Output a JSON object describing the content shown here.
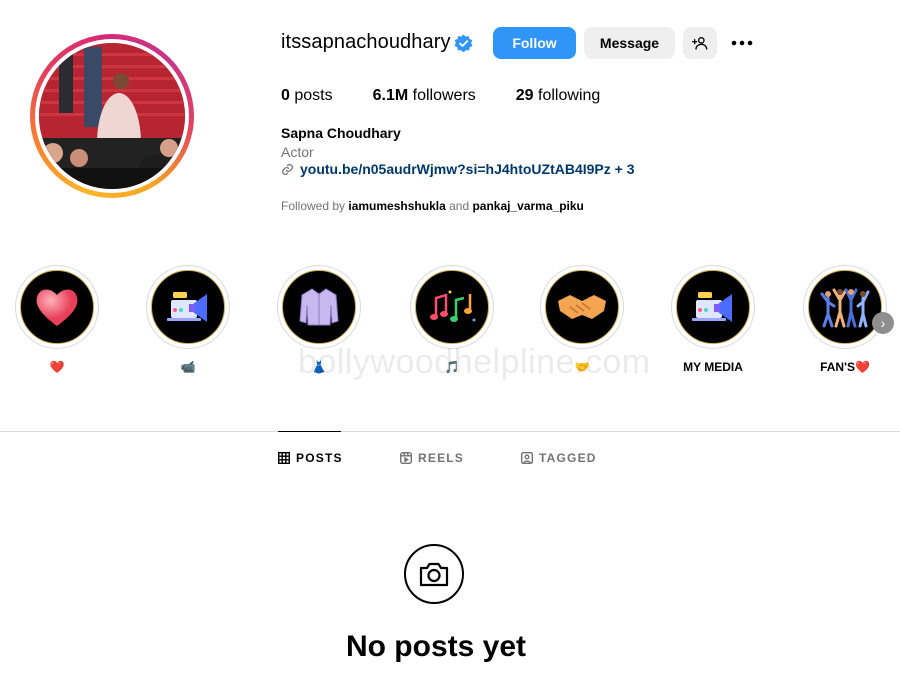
{
  "profile": {
    "username": "itssapnachoudhary",
    "full_name": "Sapna Choudhary",
    "category": "Actor",
    "link": "youtu.be/n05audrWjmw?si=hJ4htoUZtAB4I9Pz + 3",
    "followed_by_prefix": "Followed by",
    "followed_by_1": "iamumeshshukla",
    "followed_by_and": "and",
    "followed_by_2": "pankaj_varma_piku"
  },
  "actions": {
    "follow_label": "Follow",
    "message_label": "Message"
  },
  "stats": {
    "posts_count": "0",
    "posts_label": "posts",
    "followers_count": "6.1M",
    "followers_label": "followers",
    "following_count": "29",
    "following_label": "following"
  },
  "highlights": [
    {
      "label": "❤️",
      "icon": "heart-icon"
    },
    {
      "label": "📹",
      "icon": "megaphone-laptop-icon"
    },
    {
      "label": "👗",
      "icon": "jacket-icon"
    },
    {
      "label": "🎵",
      "icon": "music-notes-icon"
    },
    {
      "label": "🤝",
      "icon": "handshake-icon"
    },
    {
      "label": "MY MEDIA",
      "icon": "megaphone-laptop-icon"
    },
    {
      "label": "FAN'S❤️",
      "icon": "dancers-icon"
    }
  ],
  "watermark": "bollywoodhelpline.com",
  "tabs": [
    {
      "label": "POSTS",
      "icon": "grid-icon",
      "active": true
    },
    {
      "label": "REELS",
      "icon": "reels-icon",
      "active": false
    },
    {
      "label": "TAGGED",
      "icon": "tagged-icon",
      "active": false
    }
  ],
  "empty_state": {
    "title": "No posts yet",
    "icon": "camera-icon"
  },
  "colors": {
    "accent": "#2f95f6",
    "link": "#00376b",
    "secondary_text": "#737373",
    "verified": "#2f95f6"
  }
}
